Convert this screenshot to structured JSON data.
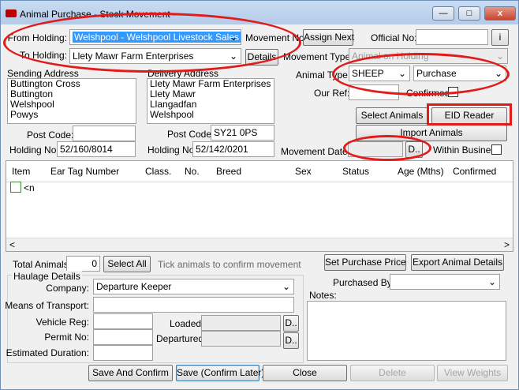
{
  "window": {
    "title": "Animal Purchase - Stock Movement -",
    "minimize_label": "—",
    "maximize_label": "□",
    "close_label": "x"
  },
  "holding": {
    "from_label": "From Holding:",
    "from_value": "Welshpool - Welshpool Livestock Sales",
    "to_label": "To Holding:",
    "to_value": "Llety Mawr Farm Enterprises",
    "details_button": "Details"
  },
  "movement": {
    "no_label": "Movement No:",
    "assign_next_button": "Assign Next",
    "official_no_label": "Official No:",
    "official_no_value": "",
    "official_no_button": "i",
    "type_label": "Movement Type:",
    "type_value": "Animal on Holding",
    "date_label": "Movement Date:",
    "date_value": "",
    "date_button": "D..",
    "within_business_label": "Within Business"
  },
  "animal": {
    "type_label": "Animal Type:",
    "type_value": "SHEEP",
    "purpose_value": "Purchase",
    "our_ref_label": "Our Ref:",
    "our_ref_value": "",
    "confirmed_label": "Confirmed:"
  },
  "sending": {
    "label": "Sending Address",
    "lines": [
      "Buttington Cross",
      "Buttington",
      "Welshpool",
      "Powys"
    ],
    "postcode_label": "Post Code:",
    "postcode_value": "",
    "holding_no_label": "Holding No:",
    "holding_no_value": "52/160/8014"
  },
  "delivery": {
    "label": "Delivery Address",
    "lines": [
      "Llety Mawr Farm Enterprises",
      "Llety Mawr",
      "Llangadfan",
      "Welshpool"
    ],
    "postcode_label": "Post Code:",
    "postcode_value": "SY21 0PS",
    "holding_no_label": "Holding No:",
    "holding_no_value": "52/142/0201"
  },
  "actions": {
    "select_animals": "Select Animals",
    "eid_reader": "EID Reader",
    "import_animals": "Import Animals"
  },
  "grid": {
    "columns": [
      "Item",
      "Ear Tag Number",
      "Class.",
      "No.",
      "Breed",
      "Sex",
      "Status",
      "Age (Mths)",
      "Confirmed"
    ],
    "new_row_text": "<n",
    "scroll_left": "<",
    "scroll_right": ">"
  },
  "totals": {
    "total_label": "Total Animals:",
    "total_value": "0",
    "select_all_button": "Select All",
    "hint": "Tick animals to confirm movement",
    "set_price_button": "Set Purchase Price",
    "export_button": "Export Animal Details"
  },
  "haulage": {
    "legend": "Haulage Details",
    "company_label": "Company:",
    "company_value": "Departure Keeper",
    "transport_label": "Means of Transport:",
    "transport_value": "",
    "vehicle_label": "Vehicle Reg:",
    "vehicle_value": "",
    "permit_label": "Permit No:",
    "permit_value": "",
    "duration_label": "Estimated Duration:",
    "duration_value": "",
    "loaded_label": "Loaded:",
    "loaded_value": "",
    "departured_label": "Departured:",
    "departured_value": "",
    "date_button": "D.."
  },
  "purchase": {
    "purchased_by_label": "Purchased By:",
    "purchased_by_value": "",
    "notes_label": "Notes:",
    "notes_value": ""
  },
  "footer": {
    "save_confirm": "Save And Confirm",
    "save_later": "Save (Confirm Later)",
    "close": "Close",
    "delete": "Delete",
    "view_weights": "View Weights"
  }
}
